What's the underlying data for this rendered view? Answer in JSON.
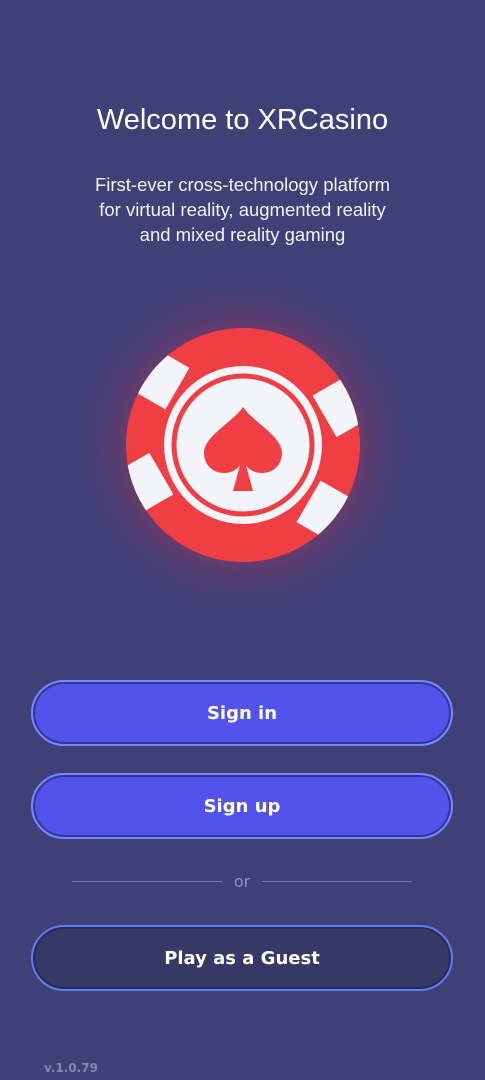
{
  "welcome": {
    "title": "Welcome to XRCasino",
    "subtitle_lines": [
      "First-ever cross-technology platform",
      "for virtual reality, augmented reality",
      "and mixed reality gaming"
    ]
  },
  "logo": {
    "icon": "poker-chip-spade-icon",
    "chip_color": "#ef3f44",
    "inner_color": "#f3f5fb",
    "glow_color": "#d8344f"
  },
  "actions": {
    "sign_in_label": "Sign in",
    "sign_up_label": "Sign up",
    "divider_label": "or",
    "guest_label": "Play as a Guest"
  },
  "colors": {
    "background": "#3f4078",
    "primary_button": "#5253ea",
    "guest_button": "#363865",
    "button_border": "#6f8cff"
  },
  "footer": {
    "version": "v.1.0.79"
  }
}
